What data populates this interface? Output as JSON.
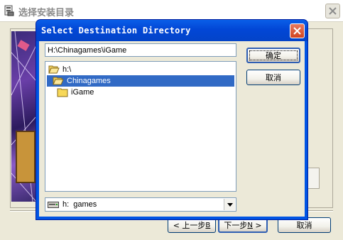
{
  "outer_window": {
    "title": "选择安装目录",
    "back_button": {
      "label": "< 上一步",
      "mnemonic": "B"
    },
    "next_button": {
      "label": "下一步",
      "mnemonic": "N",
      "suffix": " >"
    },
    "cancel_button": "取消"
  },
  "dialog": {
    "title": "Select Destination Directory",
    "path_value": "H:\\Chinagames\\iGame",
    "ok_button": "确定",
    "cancel_button": "取消",
    "tree": [
      {
        "label": "h:\\",
        "icon": "open-folder-icon",
        "selected": false
      },
      {
        "label": "Chinagames",
        "icon": "open-folder-icon",
        "selected": true
      },
      {
        "label": "iGame",
        "icon": "folder-icon",
        "selected": false
      }
    ],
    "drive": {
      "label": "h:  games",
      "icon": "drive-icon"
    }
  },
  "colors": {
    "title_bar": "#0054e3",
    "selection": "#316ac5",
    "window_bg": "#ece9d8"
  }
}
